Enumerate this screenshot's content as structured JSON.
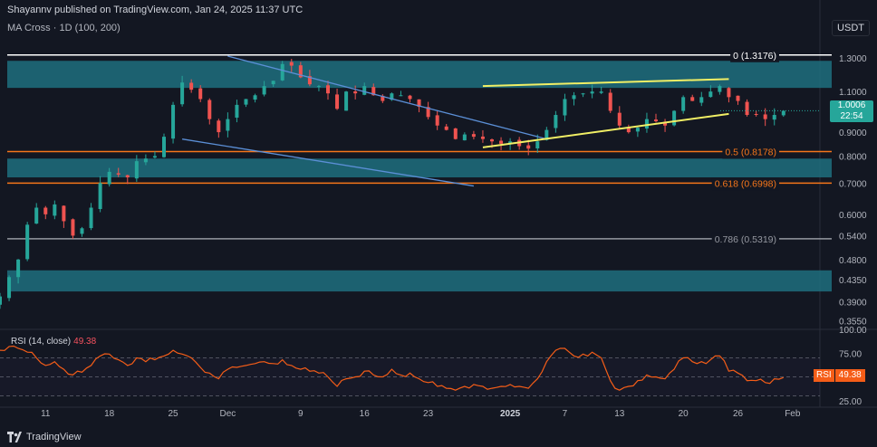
{
  "header": {
    "published": "Shayannv published on TradingView.com, Jan 24, 2025 11:37 UTC",
    "indicator": "MA Cross · 1D (100, 200)",
    "currency": "USDT"
  },
  "price_tag": {
    "price": "1.0006",
    "countdown": "22:54"
  },
  "rsi_tag": {
    "label": "RSI",
    "value": "49.38"
  },
  "rsi_title": {
    "label": "RSI (14, close)",
    "value": "49.38"
  },
  "branding": {
    "logo_text": "TradingView"
  },
  "colors": {
    "background": "#131722",
    "zone": "#1f6f7e",
    "fib_orange": "#f5761a",
    "fib_gray": "#9598a1",
    "fib_white": "#ffffff",
    "trend_blue": "#5b8fd6",
    "trend_yellow": "#f1ef65",
    "rsi_line": "#f55d18",
    "up_candle": "#26a69a",
    "down_candle": "#ef5350"
  },
  "chart_data": {
    "type": "candlestick",
    "price_axis": {
      "scale": "log",
      "range": [
        0.34,
        1.42
      ],
      "ticks": [
        1.3,
        1.1,
        0.9,
        0.8,
        0.7,
        0.6,
        0.54,
        0.48,
        0.435,
        0.39,
        0.355
      ],
      "tick_labels": [
        "1.3000",
        "1.1000",
        "0.9000",
        "0.8000",
        "0.7000",
        "0.6000",
        "0.5400",
        "0.4800",
        "0.4350",
        "0.3900",
        "0.3550"
      ]
    },
    "time_axis": {
      "range": [
        "2024-11-06",
        "2025-02-04"
      ],
      "ticks": [
        {
          "date": "2024-11-11",
          "label": "11"
        },
        {
          "date": "2024-11-18",
          "label": "18"
        },
        {
          "date": "2024-11-25",
          "label": "25"
        },
        {
          "date": "2024-12-01",
          "label": "Dec"
        },
        {
          "date": "2024-12-09",
          "label": "9"
        },
        {
          "date": "2024-12-16",
          "label": "16"
        },
        {
          "date": "2024-12-23",
          "label": "23"
        },
        {
          "date": "2025-01-01",
          "label": "2025"
        },
        {
          "date": "2025-01-07",
          "label": "7"
        },
        {
          "date": "2025-01-13",
          "label": "13"
        },
        {
          "date": "2025-01-20",
          "label": "20"
        },
        {
          "date": "2025-01-26",
          "label": "26"
        },
        {
          "date": "2025-02-01",
          "label": "Feb"
        }
      ]
    },
    "close_prices": {
      "start": "2024-11-06",
      "values": [
        0.4,
        0.44,
        0.48,
        0.57,
        0.62,
        0.6,
        0.63,
        0.58,
        0.54,
        0.56,
        0.62,
        0.7,
        0.74,
        0.73,
        0.72,
        0.78,
        0.79,
        0.8,
        0.88,
        1.03,
        1.15,
        1.11,
        1.06,
        0.96,
        0.9,
        0.96,
        1.03,
        1.06,
        1.08,
        1.13,
        1.16,
        1.26,
        1.25,
        1.18,
        1.14,
        1.13,
        1.09,
        1.01,
        1.1,
        1.09,
        1.13,
        1.08,
        1.05,
        1.09,
        1.08,
        1.06,
        1.02,
        0.97,
        0.93,
        0.91,
        0.87,
        0.89,
        0.88,
        0.87,
        0.86,
        0.85,
        0.86,
        0.84,
        0.83,
        0.86,
        0.91,
        0.98,
        1.06,
        1.08,
        1.09,
        1.1,
        1.1,
        1.0,
        0.93,
        0.9,
        0.92,
        0.96,
        0.95,
        0.93,
        1.0,
        1.07,
        1.05,
        1.07,
        1.1,
        1.13,
        1.07,
        1.05,
        0.98,
        0.98,
        0.96,
        0.98,
        1.0
      ]
    },
    "current_price": 1.0006,
    "zones": [
      {
        "from": 1.12,
        "to": 1.28
      },
      {
        "from": 0.72,
        "to": 0.79
      },
      {
        "from": 0.41,
        "to": 0.455
      }
    ],
    "fib_levels": [
      {
        "label": "0 (1.3176)",
        "value": 1.3176
      },
      {
        "label": "0.5 (0.8178)",
        "value": 0.8178
      },
      {
        "label": "0.618 (0.6998)",
        "value": 0.6998
      },
      {
        "label": "0.786 (0.5319)",
        "value": 0.5319
      }
    ],
    "trendlines": [
      {
        "color": "blue",
        "from": {
          "date": "2024-12-01",
          "price": 1.31
        },
        "to": {
          "date": "2025-01-05",
          "price": 0.87
        }
      },
      {
        "color": "blue",
        "from": {
          "date": "2024-11-26",
          "price": 0.87
        },
        "to": {
          "date": "2024-12-28",
          "price": 0.69
        }
      },
      {
        "color": "yellow",
        "from": {
          "date": "2024-12-29",
          "price": 1.13
        },
        "to": {
          "date": "2025-01-25",
          "price": 1.17
        }
      },
      {
        "color": "yellow",
        "from": {
          "date": "2024-12-29",
          "price": 0.835
        },
        "to": {
          "date": "2025-01-25",
          "price": 0.985
        }
      }
    ],
    "rsi": {
      "title": "RSI (14, close)",
      "range": [
        20,
        100
      ],
      "ticks": [
        100,
        75,
        25
      ],
      "tick_labels": [
        "100.00",
        "75.00",
        "25.00"
      ],
      "bands": [
        70,
        50,
        30
      ],
      "start": "2024-11-06",
      "values": [
        78,
        82,
        80,
        76,
        70,
        62,
        66,
        58,
        52,
        55,
        62,
        72,
        74,
        68,
        62,
        70,
        66,
        68,
        72,
        78,
        74,
        70,
        60,
        54,
        48,
        58,
        60,
        62,
        64,
        66,
        64,
        68,
        62,
        58,
        56,
        54,
        50,
        40,
        48,
        50,
        56,
        52,
        50,
        58,
        52,
        54,
        48,
        44,
        40,
        38,
        36,
        40,
        42,
        40,
        38,
        40,
        42,
        40,
        38,
        48,
        66,
        78,
        80,
        72,
        74,
        76,
        70,
        46,
        36,
        40,
        46,
        52,
        50,
        48,
        58,
        70,
        66,
        66,
        68,
        72,
        56,
        54,
        46,
        46,
        44,
        48,
        49.38
      ]
    }
  }
}
